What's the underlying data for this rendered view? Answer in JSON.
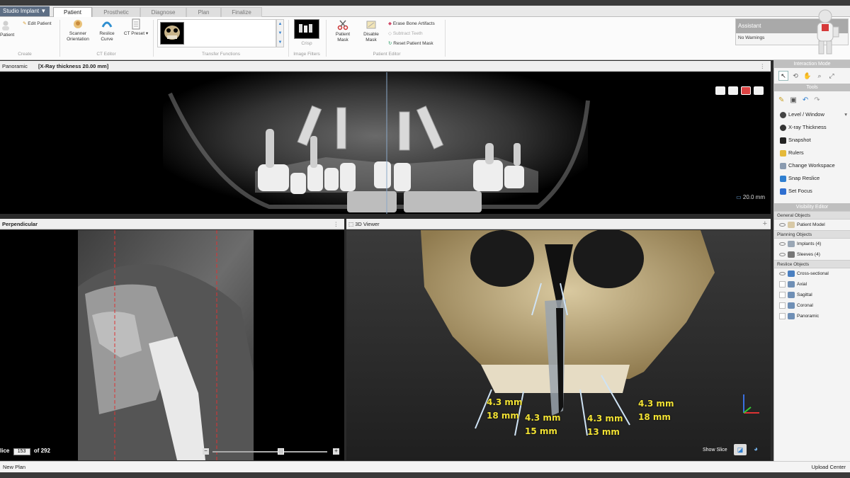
{
  "app": {
    "menu_label": "Studio Implant"
  },
  "tabs": [
    {
      "label": "Patient",
      "active": true
    },
    {
      "label": "Prosthetic"
    },
    {
      "label": "Diagnose"
    },
    {
      "label": "Plan"
    },
    {
      "label": "Finalize"
    }
  ],
  "ribbon": {
    "create": {
      "patient": "Patient",
      "edit_patient": "Edit Patient",
      "group": "Create"
    },
    "ct_editor": {
      "scanner_orientation": "Scanner Orientation",
      "reslice_curve": "Reslice Curve",
      "ct_preset": "CT Preset",
      "group": "CT Editor"
    },
    "transfer_functions": {
      "group": "Transfer Functions"
    },
    "image_filters": {
      "crisp": "Crisp",
      "group": "Image Filters"
    },
    "patient_editor": {
      "patient_mask": "Patient Mask",
      "disable_mask": "Disable Mask",
      "erase_bone": "Erase Bone Artifacts",
      "subtract_teeth": "Subtract Teeth",
      "reset_mask": "Reset Patient Mask",
      "group": "Patient Editor"
    }
  },
  "assistant": {
    "title": "Assistant",
    "status": "No Warnings"
  },
  "panoramic": {
    "title": "Panoramic",
    "thickness": "[X-Ray thickness 20.00 mm]",
    "scale": "20.0 mm"
  },
  "perpendicular": {
    "title": "Perpendicular",
    "slice_label": "lice",
    "slice_value": "153",
    "slice_total": "of 292",
    "slider_pos": 0.6
  },
  "viewer3d": {
    "title": "3D Viewer",
    "show_slice": "Show Slice",
    "measurements": [
      {
        "a": "4.3 mm",
        "b": "18 mm"
      },
      {
        "a": "4.3 mm",
        "b": "15 mm"
      },
      {
        "a": "4.3 mm",
        "b": "13 mm"
      },
      {
        "a": "4.3 mm",
        "b": "18 mm"
      }
    ]
  },
  "sidebar": {
    "interaction_mode": "Interaction Mode",
    "tools_title": "Tools",
    "tools": [
      "Level / Window",
      "X-ray Thickness",
      "Snapshot",
      "Rulers",
      "Change Workspace",
      "Snap Reslice",
      "Set Focus"
    ],
    "visibility_title": "Visibility Editor",
    "general_objects": "General Objects",
    "patient_model": "Patient Model",
    "planning_objects": "Planning Objects",
    "implants": "Implants (4)",
    "sleeves": "Sleeves (4)",
    "reslice_objects": "Reslice Objects",
    "reslice_items": [
      "Cross-sectional",
      "Axial",
      "Sagittal",
      "Coronal",
      "Panoramic"
    ]
  },
  "status": {
    "left": "New Plan",
    "right": "Upload Center"
  },
  "colors": {
    "accent": "#f2e234",
    "menu": "#5d6e84"
  }
}
